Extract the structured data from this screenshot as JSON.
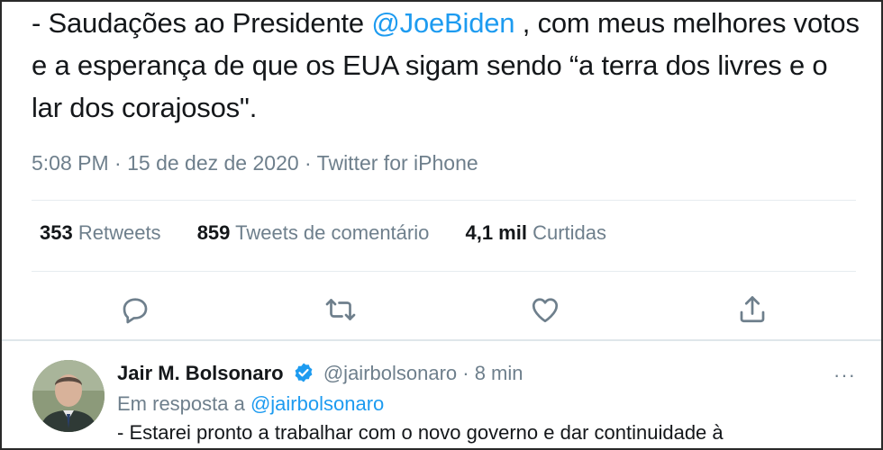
{
  "tweet": {
    "text_before": "- Saudações ao Presidente ",
    "mention": "@JoeBiden",
    "text_after": " , com meus melhores votos e a esperança de que os EUA sigam sendo “a terra dos livres e o lar dos corajosos\".",
    "meta": "5:08 PM · 15 de dez de 2020 · Twitter for iPhone"
  },
  "stats": {
    "retweets_count": "353",
    "retweets_label": "Retweets",
    "quotes_count": "859",
    "quotes_label": "Tweets de comentário",
    "likes_count": "4,1 mil",
    "likes_label": "Curtidas"
  },
  "actions": {
    "reply_icon": "reply-icon",
    "retweet_icon": "retweet-icon",
    "like_icon": "like-icon",
    "share_icon": "share-icon"
  },
  "reply": {
    "name": "Jair M. Bolsonaro",
    "handle": "@jairbolsonaro",
    "time": "· 8 min",
    "more": "···",
    "reply_prefix": "Em resposta a ",
    "reply_mention": "@jairbolsonaro",
    "text": "- Estarei pronto a trabalhar com o novo governo e dar continuidade à"
  },
  "colors": {
    "accent": "#1d9bf0",
    "secondary_text": "#6e7f8c",
    "primary_text": "#14171a"
  }
}
